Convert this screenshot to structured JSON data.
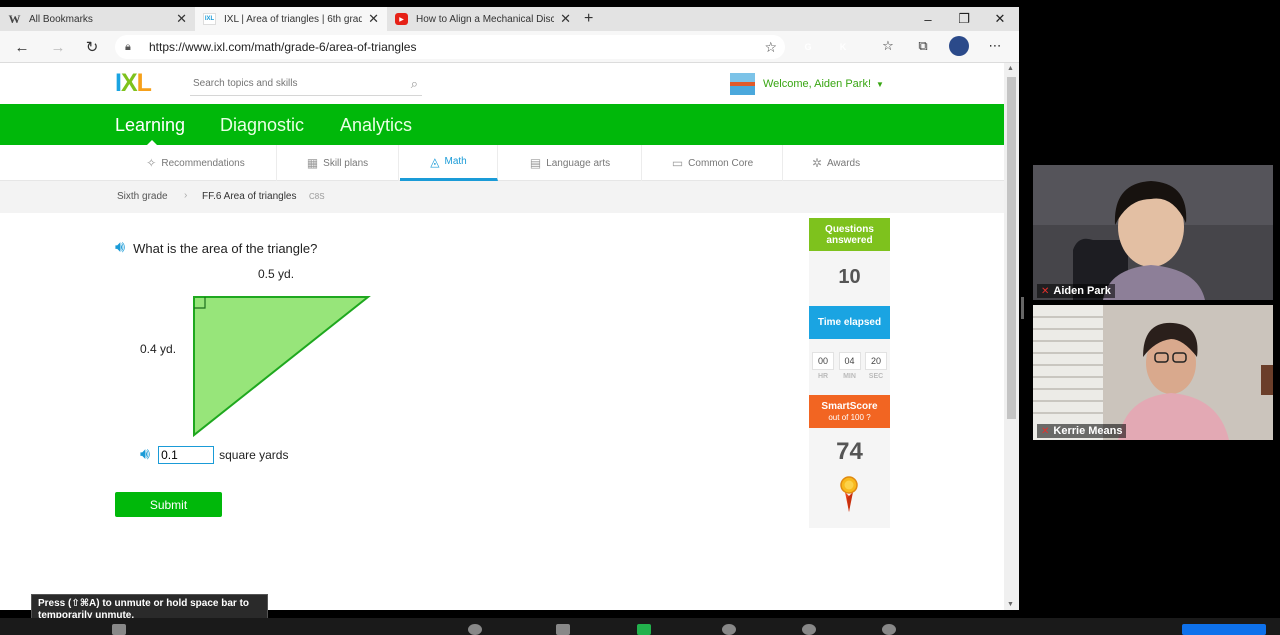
{
  "browser": {
    "tabs": [
      {
        "icon": "W",
        "title": "All Bookmarks",
        "close": "✕"
      },
      {
        "icon": "IXL",
        "title": "IXL | Area of triangles | 6th grade",
        "close": "✕"
      },
      {
        "icon": "▶",
        "title": "How to Align a Mechanical Disc",
        "close": "✕"
      }
    ],
    "new_tab": "+",
    "window_controls": {
      "minimize": "–",
      "restore": "❐",
      "close": "✕"
    },
    "url": "https://www.ixl.com/math/grade-6/area-of-triangles",
    "extensions": [
      {
        "name": "grammarly",
        "letter": "G",
        "color": "#15c39a"
      },
      {
        "name": "kami",
        "letter": "K",
        "color": "#4a5bd4"
      }
    ],
    "more": "⋯"
  },
  "ixl": {
    "logo": {
      "i": "I",
      "x": "X",
      "l": "L"
    },
    "search_placeholder": "Search topics and skills",
    "welcome": "Welcome, Aiden Park!",
    "main_tabs": [
      "Learning",
      "Diagnostic",
      "Analytics"
    ],
    "sub_tabs": [
      "Recommendations",
      "Skill plans",
      "Math",
      "Language arts",
      "Common Core",
      "Awards"
    ],
    "breadcrumb": {
      "grade": "Sixth grade",
      "separator": "›",
      "skill": "FF.6 Area of triangles",
      "code": "C8S"
    }
  },
  "problem": {
    "prompt": "What is the area of the triangle?",
    "top_side": "0.5 yd.",
    "left_side": "0.4 yd.",
    "answer_value": "0.1",
    "unit": "square yards",
    "submit": "Submit"
  },
  "stats": {
    "questions_label": "Questions answered",
    "questions_value": "10",
    "time_label": "Time elapsed",
    "time": [
      {
        "value": "00",
        "unit": "HR"
      },
      {
        "value": "04",
        "unit": "MIN"
      },
      {
        "value": "20",
        "unit": "SEC"
      }
    ],
    "smartscore_label": "SmartScore",
    "smartscore_sub": "out of 100",
    "smartscore_value": "74"
  },
  "zoom": {
    "participants": [
      "Aiden Park",
      "Kerrie Means"
    ],
    "tooltip": "Press  (⇧⌘A) to unmute or hold space bar to temporarily unmute."
  },
  "colors": {
    "ixl_green": "#00b80a",
    "ixl_blue": "#1a9bd7",
    "smartscore_orange": "#f26522",
    "triangle_fill": "#97e57a"
  }
}
